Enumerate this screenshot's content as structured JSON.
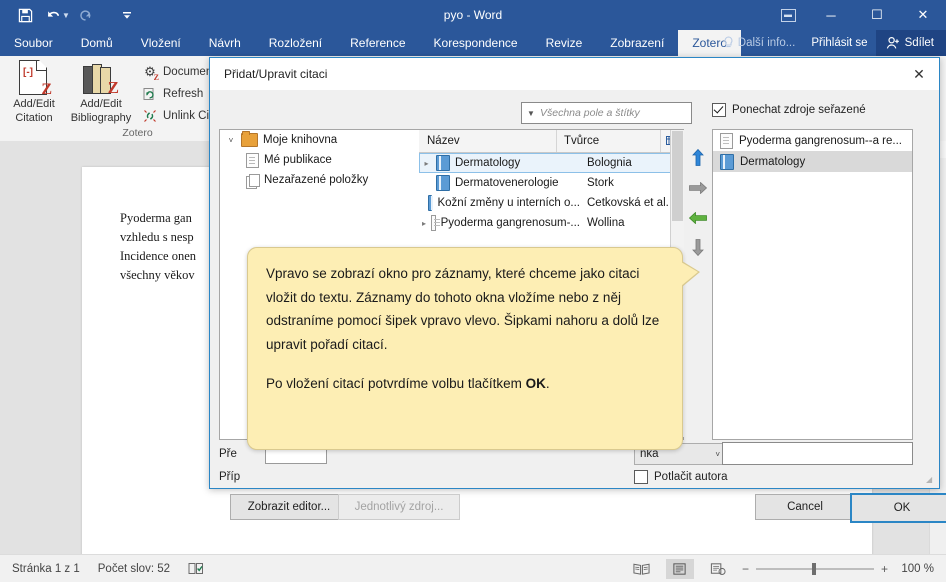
{
  "window": {
    "title": "pyo - Word",
    "qat": [
      {
        "name": "save",
        "glyph": "💾"
      },
      {
        "name": "undo",
        "glyph": "↶"
      },
      {
        "name": "redo",
        "glyph": "↷"
      },
      {
        "name": "customize",
        "glyph": "⩟"
      }
    ],
    "controls": {
      "ribbon_display": "▣",
      "minimize": "─",
      "maximize": "☐",
      "close": "✕"
    }
  },
  "ribbon": {
    "tabs": [
      {
        "label": "Soubor",
        "active": false
      },
      {
        "label": "Domů",
        "active": false
      },
      {
        "label": "Vložení",
        "active": false
      },
      {
        "label": "Návrh",
        "active": false
      },
      {
        "label": "Rozložení",
        "active": false
      },
      {
        "label": "Reference",
        "active": false
      },
      {
        "label": "Korespondence",
        "active": false
      },
      {
        "label": "Revize",
        "active": false
      },
      {
        "label": "Zobrazení",
        "active": false
      },
      {
        "label": "Zotero",
        "active": true
      }
    ],
    "tell_me": "Další info...",
    "sign_in": "Přihlásit se",
    "share": "Sdílet",
    "group_label": "Zotero",
    "buttons": {
      "add_edit_citation": "Add/Edit\nCitation",
      "add_edit_citation_l1": "Add/Edit",
      "add_edit_citation_l2": "Citation",
      "add_edit_bibliography_l1": "Add/Edit",
      "add_edit_bibliography_l2": "Bibliography",
      "document_prefs": "Document P",
      "refresh": "Refresh",
      "unlink": "Unlink Citati"
    }
  },
  "document": {
    "lines": [
      "Pyoderma  gan",
      "vzhledu s nesp",
      "Incidence onen",
      "všechny věkov"
    ]
  },
  "dialog": {
    "title": "Přidat/Upravit citaci",
    "close_glyph": "✕",
    "search": {
      "placeholder": "Všechna pole a štítky",
      "caret": "▼"
    },
    "keep_sorted_label": "Ponechat zdroje seřazené",
    "keep_sorted_checked": true,
    "tree": [
      {
        "label": "Moje knihovna",
        "icon": "folder-icon",
        "twisty": "˅",
        "level": 0
      },
      {
        "label": "Mé publikace",
        "icon": "document-icon",
        "twisty": "",
        "level": 1
      },
      {
        "label": "Nezařazené položky",
        "icon": "documents-icon",
        "twisty": "",
        "level": 1
      }
    ],
    "list": {
      "columns": [
        "Název",
        "Tvůrce"
      ],
      "column_picker_glyph": "⊞",
      "rows": [
        {
          "title": "Dermatology",
          "creator": "Bolognia",
          "icon": "book-icon",
          "expandable": true,
          "selected": true
        },
        {
          "title": "Dermatovenerologie",
          "creator": "Štork",
          "icon": "book-icon",
          "expandable": false,
          "selected": false
        },
        {
          "title": "Kožní změny u interních o...",
          "creator": "Cetkovská et al.",
          "icon": "book-icon",
          "expandable": false,
          "selected": false
        },
        {
          "title": "Pyoderma gangrenosum-...",
          "creator": "Wollina",
          "icon": "journal-icon",
          "expandable": true,
          "selected": false
        }
      ]
    },
    "arrows": [
      {
        "name": "move-up-arrow",
        "glyph": "⬆",
        "color": "#2f86d8"
      },
      {
        "name": "add-right-arrow",
        "glyph": "➡",
        "color": "#8d8d8d"
      },
      {
        "name": "remove-left-arrow",
        "glyph": "⬅",
        "color": "#57a93c"
      },
      {
        "name": "move-down-arrow",
        "glyph": "⬇",
        "color": "#8d8d8d"
      }
    ],
    "selected_items": [
      {
        "label": "Pyoderma gangrenosum--a re...",
        "icon": "journal-icon",
        "selected": false
      },
      {
        "label": "Dermatology",
        "icon": "book-icon",
        "selected": true
      }
    ],
    "fields": {
      "prefix_label": "Pře",
      "suffix_label": "Příp",
      "prefix_value": "",
      "locator_type": "nka",
      "locator_caret": "˅",
      "locator_value": "",
      "suppress_author_label": "Potlačit autora",
      "suppress_author_checked": false
    },
    "buttons": {
      "show_editor": "Zobrazit editor...",
      "single_source": "Jednotlivý zdroj...",
      "cancel": "Cancel",
      "ok": "OK"
    }
  },
  "callout": {
    "paragraph1": "Vpravo se zobrazí okno pro záznamy, které chceme jako citaci vložit do textu. Záznamy do tohoto okna vložíme nebo z něj odstraníme pomocí šipek vpravo vlevo. Šipkami nahoru a dolů lze upravit pořadí citací.",
    "paragraph2_pre": "Po vložení citací potvrdíme volbu tlačítkem ",
    "paragraph2_bold": "OK",
    "paragraph2_post": "."
  },
  "status_bar": {
    "page": "Stránka 1 z 1",
    "words": "Počet slov: 52",
    "proofing_icon": "proofing-icon",
    "views": [
      {
        "name": "read-mode-view-button",
        "glyph": "📖",
        "selected": false
      },
      {
        "name": "print-layout-view-button",
        "glyph": "▤",
        "selected": true
      },
      {
        "name": "web-layout-view-button",
        "glyph": "▦",
        "selected": false
      }
    ],
    "zoom_out": "−",
    "zoom_in": "+",
    "zoom_value": "100 %"
  },
  "colors": {
    "word_blue": "#2b579a",
    "accent_blue": "#2b86c5",
    "callout_bg": "#fdeeb4"
  }
}
